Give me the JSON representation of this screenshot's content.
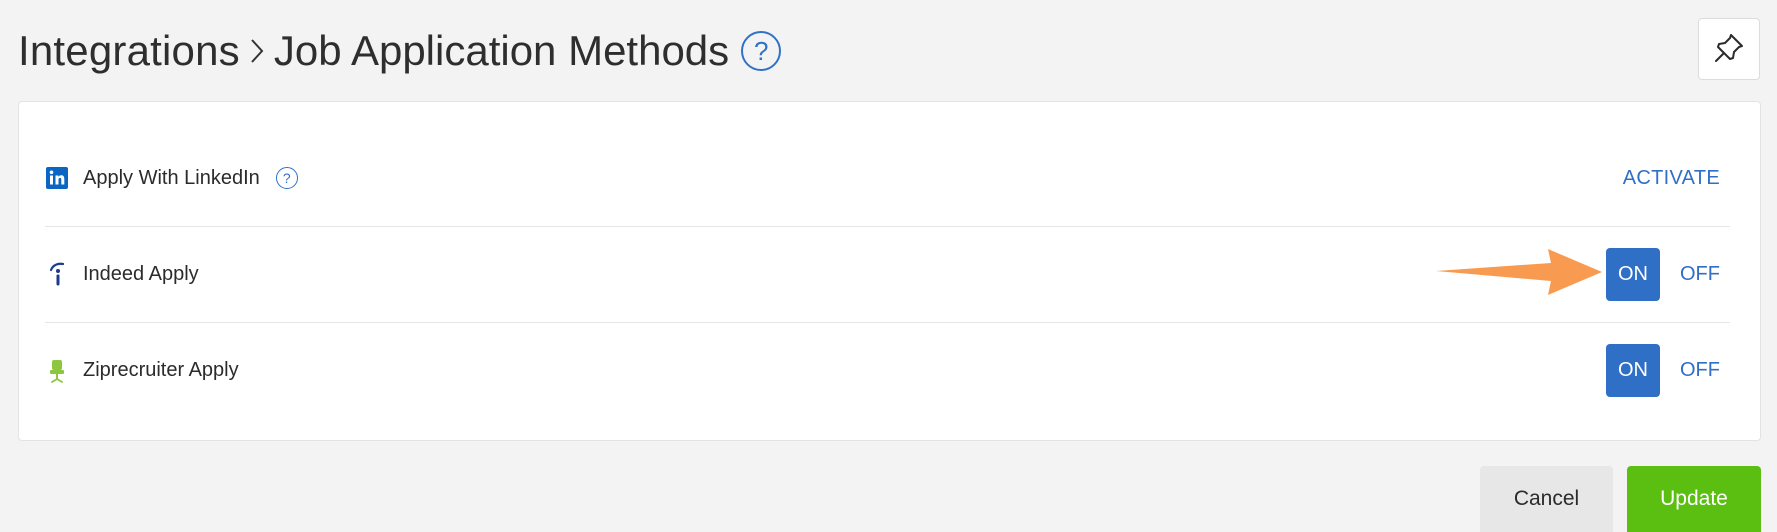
{
  "header": {
    "breadcrumb_parent": "Integrations",
    "breadcrumb_current": "Job Application Methods",
    "help_glyph": "?"
  },
  "toolbar": {
    "pin_icon": "pin-icon"
  },
  "integrations": [
    {
      "label": "Apply With LinkedIn",
      "icon": "linkedin-icon",
      "help_glyph": "?",
      "action_label": "ACTIVATE"
    },
    {
      "label": "Indeed Apply",
      "icon": "indeed-icon",
      "on_label": "ON",
      "off_label": "OFF",
      "state": "on"
    },
    {
      "label": "Ziprecruiter Apply",
      "icon": "ziprecruiter-icon",
      "on_label": "ON",
      "off_label": "OFF",
      "state": "on"
    }
  ],
  "footer": {
    "cancel_label": "Cancel",
    "update_label": "Update"
  },
  "colors": {
    "accent_blue": "#2f6fc5",
    "update_green": "#5bbf12",
    "annotation_orange": "#f89a4f",
    "linkedin_blue": "#0a66c2",
    "ziprecruiter_green": "#8dc63f"
  }
}
